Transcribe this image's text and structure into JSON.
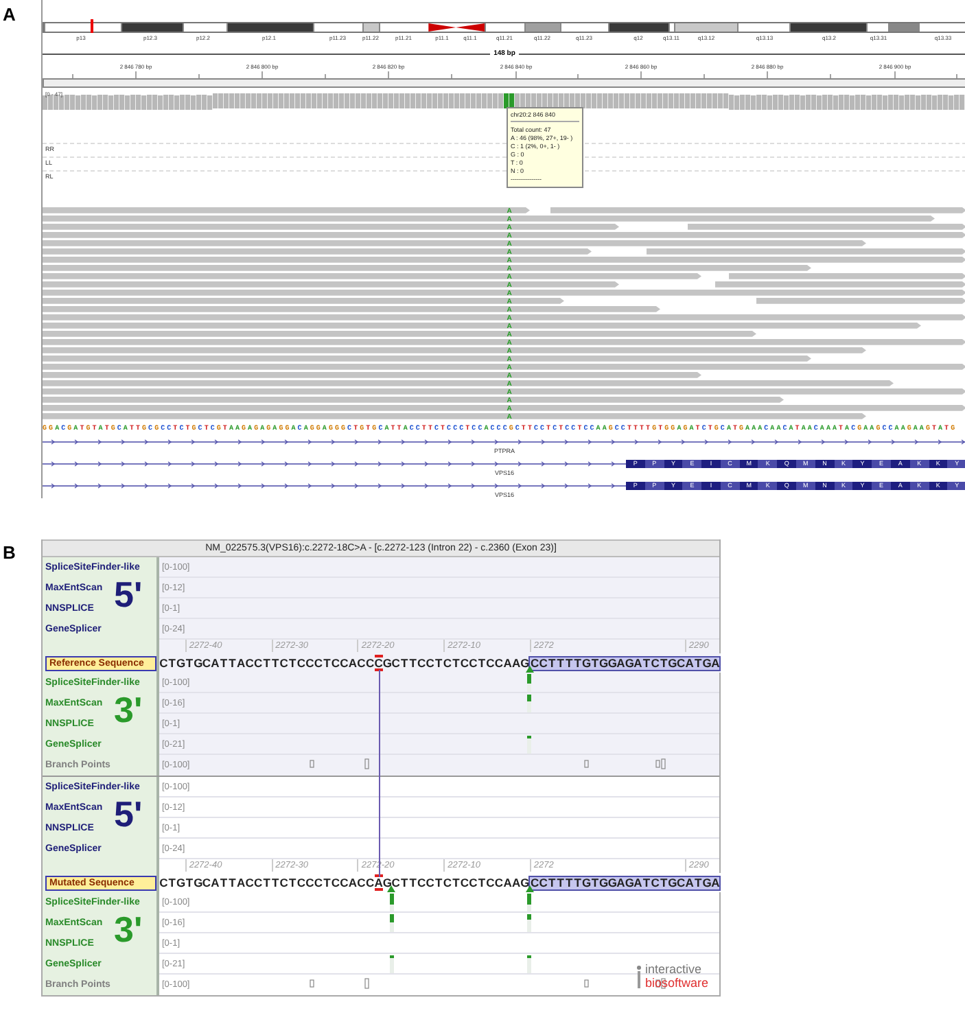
{
  "panel_a": {
    "label": "A",
    "ideogram": [
      {
        "label": "p13",
        "kind": "band",
        "color": "#ffffff",
        "selected": true
      },
      {
        "label": "p12.3",
        "kind": "band",
        "color": "#3a3a3a",
        "selected": false
      },
      {
        "label": "p12.2",
        "kind": "band",
        "color": "#ffffff",
        "selected": false
      },
      {
        "label": "p12.1",
        "kind": "band",
        "color": "#3a3a3a",
        "selected": false
      },
      {
        "label": "p11.23",
        "kind": "band",
        "color": "#ffffff",
        "selected": false
      },
      {
        "label": "p11.22",
        "kind": "band",
        "color": "#c8c8c8",
        "selected": false
      },
      {
        "label": "p11.21",
        "kind": "band",
        "color": "#ffffff",
        "selected": false
      },
      {
        "label": "p11.1",
        "kind": "centromere_p",
        "color": "#cc0000",
        "selected": false
      },
      {
        "label": "q11.1",
        "kind": "centromere_q",
        "color": "#cc0000",
        "selected": false
      },
      {
        "label": "q11.21",
        "kind": "band",
        "color": "#ffffff",
        "selected": false
      },
      {
        "label": "q11.22",
        "kind": "band",
        "color": "#a0a0a0",
        "selected": false
      },
      {
        "label": "q11.23",
        "kind": "band",
        "color": "#ffffff",
        "selected": false
      },
      {
        "label": "q12",
        "kind": "band",
        "color": "#3a3a3a",
        "selected": false
      },
      {
        "label": "q13.11",
        "kind": "band",
        "color": "#ffffff",
        "selected": false
      },
      {
        "label": "q13.12",
        "kind": "band",
        "color": "#c8c8c8",
        "selected": false
      },
      {
        "label": "q13.13",
        "kind": "band",
        "color": "#ffffff",
        "selected": false
      },
      {
        "label": "q13.2",
        "kind": "band",
        "color": "#3a3a3a",
        "selected": false
      },
      {
        "label": "q13.31",
        "kind": "band",
        "color": "#ffffff",
        "selected": false
      },
      {
        "kind": "band",
        "color": "#888888",
        "selected": false
      },
      {
        "label": "q13.33",
        "kind": "band",
        "color": "#ffffff",
        "selected": false
      }
    ],
    "ruler": {
      "span": "148 bp",
      "ticks": [
        "2 846 780 bp",
        "2 846 800 bp",
        "2 846 820 bp",
        "2 846 840 bp",
        "2 846 860 bp",
        "2 846 880 bp",
        "2 846 900 bp"
      ]
    },
    "coverage": {
      "range": "[0 - 47]"
    },
    "tooltip": {
      "title": "chr20:2 846 840",
      "lines": [
        "Total count: 47",
        "A : 46 (98%, 27+, 19- )",
        "C : 1 (2%, 0+, 1- )",
        "G : 0",
        "T : 0",
        "N : 0",
        "---------------"
      ]
    },
    "track_labels": [
      "RR",
      "LL",
      "RL"
    ],
    "reads": {
      "mismatches": [
        "A",
        "A",
        "A",
        "A",
        "A",
        "A",
        "A",
        "A",
        "A",
        "A",
        "A",
        "A",
        "A",
        "A",
        "A",
        "A",
        "A",
        "A",
        "A",
        "A",
        "A",
        "A",
        "A",
        "A",
        "A",
        "A"
      ]
    },
    "reference_sequence": "GGACGATGTATGCATTGCGCCTCTGCTCGTAAGAGAGAGGACAGGAGGGCTGTGCATTACCTTCTCCCTCCACCCGCTTCCTCTCCTCCAAGCCTTTTGTGGAGATCTGCATGAAACAACATAACAAATACGAAGCCAAGAAGTATG",
    "genes": [
      {
        "name": "PTPRA",
        "kind": "intron"
      },
      {
        "name": "VPS16",
        "kind": "coding",
        "protein": "P P Y E I C M K Q M N K Y E A K K Y"
      },
      {
        "name": "VPS16",
        "kind": "coding",
        "protein": "P P Y E I C M K Q M N K Y E A K K Y"
      }
    ]
  },
  "panel_b": {
    "label": "B",
    "title": "NM_022575.3(VPS16):c.2272-18C>A - [c.2272-123 (Intron 22) - c.2360 (Exon 23)]",
    "blocks": [
      {
        "kind": "reference",
        "donor": {
          "badge": "5'",
          "rows": [
            {
              "name": "SpliceSiteFinder-like",
              "range": "[0-100]"
            },
            {
              "name": "MaxEntScan",
              "range": "[0-12]"
            },
            {
              "name": "NNSPLICE",
              "range": "[0-1]"
            },
            {
              "name": "GeneSplicer",
              "range": "[0-24]"
            }
          ]
        },
        "ruler": [
          "2272-40",
          "2272-30",
          "2272-20",
          "2272-10",
          "2272",
          "2290"
        ],
        "sequence": {
          "label": "Reference Sequence",
          "intron_before": "CTGTGCATTACCTTCTCCCTCCACC",
          "variant": "C",
          "intron_after": "GCTTCCTCTCCTCCAAG",
          "exon": "CCTTTTGTGGAGATCTGCATGA"
        },
        "acceptor": {
          "badge": "3'",
          "rows": [
            {
              "name": "SpliceSiteFinder-like",
              "range": "[0-100]",
              "hits": [
                {
                  "kind": "native",
                  "level": 0.55
                }
              ]
            },
            {
              "name": "MaxEntScan",
              "range": "[0-16]",
              "hits": [
                {
                  "kind": "native",
                  "level": 0.35
                }
              ]
            },
            {
              "name": "NNSPLICE",
              "range": "[0-1]"
            },
            {
              "name": "GeneSplicer",
              "range": "[0-21]",
              "hits": [
                {
                  "kind": "native",
                  "level": 0.12
                }
              ]
            }
          ]
        },
        "branch_points": {
          "name": "Branch Points",
          "range": "[0-100]"
        }
      },
      {
        "kind": "mutated",
        "donor": {
          "badge": "5'",
          "rows": [
            {
              "name": "SpliceSiteFinder-like",
              "range": "[0-100]"
            },
            {
              "name": "MaxEntScan",
              "range": "[0-12]"
            },
            {
              "name": "NNSPLICE",
              "range": "[0-1]"
            },
            {
              "name": "GeneSplicer",
              "range": "[0-24]"
            }
          ]
        },
        "ruler": [
          "2272-40",
          "2272-30",
          "2272-20",
          "2272-10",
          "2272",
          "2290"
        ],
        "sequence": {
          "label": "Mutated Sequence",
          "intron_before": "CTGTGCATTACCTTCTCCCTCCACC",
          "variant": "A",
          "intron_after": "GCTTCCTCTCCTCCAAG",
          "exon": "CCTTTTGTGGAGATCTGCATGA"
        },
        "acceptor": {
          "badge": "3'",
          "rows": [
            {
              "name": "SpliceSiteFinder-like",
              "range": "[0-100]",
              "hits": [
                {
                  "kind": "cryptic",
                  "level": 0.6
                },
                {
                  "kind": "native",
                  "level": 0.6
                }
              ]
            },
            {
              "name": "MaxEntScan",
              "range": "[0-16]",
              "hits": [
                {
                  "kind": "cryptic",
                  "level": 0.45
                },
                {
                  "kind": "native",
                  "level": 0.3
                }
              ]
            },
            {
              "name": "NNSPLICE",
              "range": "[0-1]"
            },
            {
              "name": "GeneSplicer",
              "range": "[0-21]",
              "hits": [
                {
                  "kind": "cryptic",
                  "level": 0.12
                },
                {
                  "kind": "native",
                  "level": 0.12
                }
              ]
            }
          ]
        },
        "branch_points": {
          "name": "Branch Points",
          "range": "[0-100]"
        }
      }
    ],
    "logo": [
      "interactive",
      "biosoftware"
    ]
  }
}
